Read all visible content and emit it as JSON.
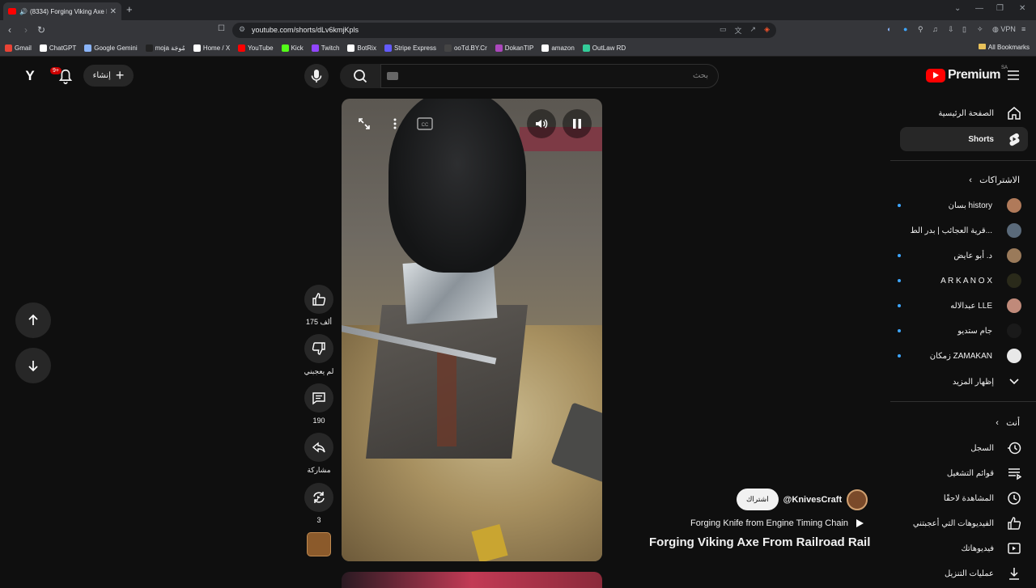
{
  "browser": {
    "tab_title": "(8334) Forging Viking Axe F",
    "url": "youtube.com/shorts/dLv6kmjKpls",
    "bookmarks": [
      "Gmail",
      "ChatGPT",
      "Google Gemini",
      "moja مُوجَة",
      "Home / X",
      "YouTube",
      "Kick",
      "Twitch",
      "BotRix",
      "Stripe Express",
      "ooTd.BY.Cr",
      "DokanTIP",
      "amazon",
      "OutLaw RD"
    ],
    "bookmark_colors": [
      "#ea4335",
      "#ffffff",
      "#8ab4f8",
      "#222222",
      "#ffffff",
      "#ff0000",
      "#53fc18",
      "#9146ff",
      "#ffffff",
      "#635bff",
      "#444444",
      "#ab47bc",
      "#ffffff",
      "#33cc99"
    ],
    "all_bookmarks": "All Bookmarks",
    "vpn": "VPN"
  },
  "header": {
    "notification_badge": "9+",
    "create_label": "إنشاء",
    "search_placeholder": "بحث",
    "logo_text": "Premium",
    "region": "SA"
  },
  "sidebar": {
    "home": "الصفحة الرئيسية",
    "shorts": "Shorts",
    "subscriptions_heading": "الاشتراكات",
    "subscriptions": [
      {
        "name": "بسان history",
        "color": "#b07a5a",
        "new": true
      },
      {
        "name": "قرية العجائب | بدر الط...",
        "color": "#5a6a7a",
        "new": false
      },
      {
        "name": "د. أبو عايض",
        "color": "#9a7a5a",
        "new": true
      },
      {
        "name": "A R K A N O X",
        "color": "#2a2a1a",
        "new": true
      },
      {
        "name": "عبدالاله LLE",
        "color": "#c08a7a",
        "new": true
      },
      {
        "name": "جام ستديو",
        "color": "#1a1a1a",
        "new": true
      },
      {
        "name": "زمكان ZAMAKAN",
        "color": "#e8e8e8",
        "new": true
      }
    ],
    "show_more": "إظهار المزيد",
    "you_heading": "أنت",
    "you_items": [
      "السجل",
      "قوائم التشغيل",
      "المشاهدة لاحقًا",
      "الفيديوهات التي أعجبتني",
      "فيديوهاتك",
      "عمليات التنزيل"
    ]
  },
  "actions": {
    "likes": "175 ألف",
    "dislike": "لم يعجبني",
    "comments": "190",
    "share": "مشاركة",
    "remix": "3"
  },
  "video": {
    "channel": "@KnivesCraft",
    "subscribe": "اشتراك",
    "playlist": "Forging Knife from Engine Timing Chain",
    "title": "Forging Viking Axe From Railroad Rail"
  }
}
